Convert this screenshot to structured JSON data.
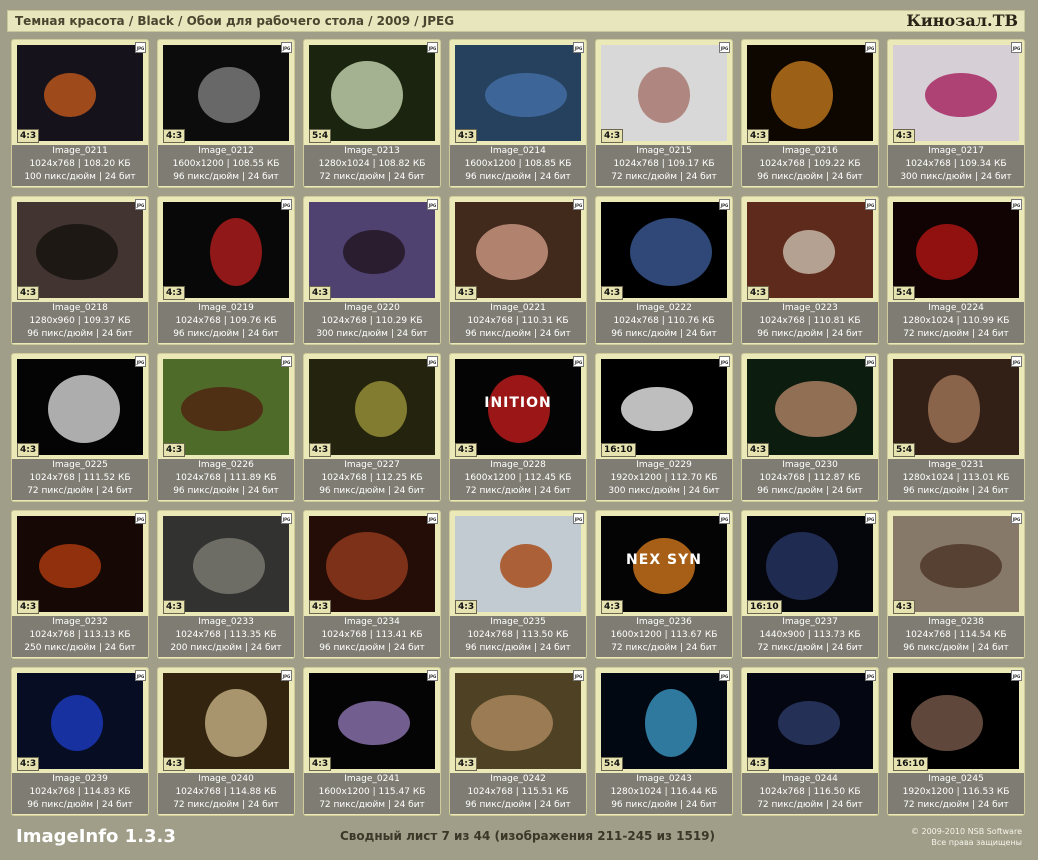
{
  "header": {
    "breadcrumb": "Темная красота / Black / Обои для рабочего стола / 2009 / JPEG",
    "brand": "Кинозал.ТВ"
  },
  "badge_jpg": "JPG",
  "cards": [
    {
      "name": "Image_0211",
      "size": "1024x768 | 108.20 КБ",
      "info": "100 пикс/дюйм | 24 бит",
      "ratio": "4:3",
      "bg": "#1a1520",
      "fg": "#d06020"
    },
    {
      "name": "Image_0212",
      "size": "1600x1200 | 108.55 КБ",
      "info": "96 пикс/дюйм | 24 бит",
      "ratio": "4:3",
      "bg": "#0e0e0e",
      "fg": "#8a8a8a"
    },
    {
      "name": "Image_0213",
      "size": "1280x1024 | 108.82 КБ",
      "info": "72 пикс/дюйм | 24 бит",
      "ratio": "5:4",
      "bg": "#1e2a10",
      "fg": "#d8e8c0"
    },
    {
      "name": "Image_0214",
      "size": "1600x1200 | 108.85 КБ",
      "info": "96 пикс/дюйм | 24 бит",
      "ratio": "4:3",
      "bg": "#2c4a6a",
      "fg": "#4b7ab8"
    },
    {
      "name": "Image_0215",
      "size": "1024x768 | 109.17 КБ",
      "info": "72 пикс/дюйм | 24 бит",
      "ratio": "4:3",
      "bg": "#f6f6f6",
      "fg": "#c08a80"
    },
    {
      "name": "Image_0216",
      "size": "1024x768 | 109.22 КБ",
      "info": "96 пикс/дюйм | 24 бит",
      "ratio": "4:3",
      "bg": "#100800",
      "fg": "#d08020"
    },
    {
      "name": "Image_0217",
      "size": "1024x768 | 109.34 КБ",
      "info": "300 пикс/дюйм | 24 бит",
      "ratio": "4:3",
      "bg": "#f4ecf4",
      "fg": "#c03070"
    },
    {
      "name": "Image_0218",
      "size": "1280x960 | 109.37 КБ",
      "info": "96 пикс/дюйм | 24 бит",
      "ratio": "4:3",
      "bg": "#4a3c38",
      "fg": "#1c1614"
    },
    {
      "name": "Image_0219",
      "size": "1024x768 | 109.76 КБ",
      "info": "96 пикс/дюйм | 24 бит",
      "ratio": "4:3",
      "bg": "#0a0a0a",
      "fg": "#c02020"
    },
    {
      "name": "Image_0220",
      "size": "1024x768 | 110.29 КБ",
      "info": "300 пикс/дюйм | 24 бит",
      "ratio": "4:3",
      "bg": "#5a4a80",
      "fg": "#2a1a2a"
    },
    {
      "name": "Image_0221",
      "size": "1024x768 | 110.31 КБ",
      "info": "96 пикс/дюйм | 24 бит",
      "ratio": "4:3",
      "bg": "#4a3020",
      "fg": "#e0a890"
    },
    {
      "name": "Image_0222",
      "size": "1024x768 | 110.76 КБ",
      "info": "96 пикс/дюйм | 24 бит",
      "ratio": "4:3",
      "bg": "#000000",
      "fg": "#4060a0"
    },
    {
      "name": "Image_0223",
      "size": "1024x768 | 110.81 КБ",
      "info": "96 пикс/дюйм | 24 бит",
      "ratio": "4:3",
      "bg": "#6a3020",
      "fg": "#e0d0c0"
    },
    {
      "name": "Image_0224",
      "size": "1280x1024 | 110.99 КБ",
      "info": "72 пикс/дюйм | 24 бит",
      "ratio": "5:4",
      "bg": "#140404",
      "fg": "#c01818"
    },
    {
      "name": "Image_0225",
      "size": "1024x768 | 111.52 КБ",
      "info": "72 пикс/дюйм | 24 бит",
      "ratio": "4:3",
      "bg": "#050505",
      "fg": "#e8e8e8"
    },
    {
      "name": "Image_0226",
      "size": "1024x768 | 111.89 КБ",
      "info": "96 пикс/дюйм | 24 бит",
      "ratio": "4:3",
      "bg": "#5a7a30",
      "fg": "#5a2c14"
    },
    {
      "name": "Image_0227",
      "size": "1024x768 | 112.25 КБ",
      "info": "96 пикс/дюйм | 24 бит",
      "ratio": "4:3",
      "bg": "#2a2a10",
      "fg": "#a8a040"
    },
    {
      "name": "Image_0228",
      "size": "1600x1200 | 112.45 КБ",
      "info": "72 пикс/дюйм | 24 бит",
      "ratio": "4:3",
      "bg": "#050505",
      "fg": "#d02020",
      "text": "INITION"
    },
    {
      "name": "Image_0229",
      "size": "1920x1200 | 112.70 КБ",
      "info": "300 пикс/дюйм | 24 бит",
      "ratio": "16:10",
      "bg": "#000000",
      "fg": "#ffffff"
    },
    {
      "name": "Image_0230",
      "size": "1024x768 | 112.87 КБ",
      "info": "96 пикс/дюйм | 24 бит",
      "ratio": "4:3",
      "bg": "#0e2010",
      "fg": "#c09070"
    },
    {
      "name": "Image_0231",
      "size": "1280x1024 | 113.01 КБ",
      "info": "96 пикс/дюйм | 24 бит",
      "ratio": "5:4",
      "bg": "#3a2418",
      "fg": "#b08060"
    },
    {
      "name": "Image_0232",
      "size": "1024x768 | 113.13 КБ",
      "info": "250 пикс/дюйм | 24 бит",
      "ratio": "4:3",
      "bg": "#1a0a06",
      "fg": "#c04010"
    },
    {
      "name": "Image_0233",
      "size": "1024x768 | 113.35 КБ",
      "info": "200 пикс/дюйм | 24 бит",
      "ratio": "4:3",
      "bg": "#3a3a38",
      "fg": "#8a8a80"
    },
    {
      "name": "Image_0234",
      "size": "1024x768 | 113.41 КБ",
      "info": "96 пикс/дюйм | 24 бит",
      "ratio": "4:3",
      "bg": "#2a0e08",
      "fg": "#a04020"
    },
    {
      "name": "Image_0235",
      "size": "1024x768 | 113.50 КБ",
      "info": "96 пикс/дюйм | 24 бит",
      "ratio": "4:3",
      "bg": "#dfe8f0",
      "fg": "#c05820"
    },
    {
      "name": "Image_0236",
      "size": "1600x1200 | 113.67 КБ",
      "info": "72 пикс/дюйм | 24 бит",
      "ratio": "4:3",
      "bg": "#050505",
      "fg": "#e08020",
      "text": "NEX SYN"
    },
    {
      "name": "Image_0237",
      "size": "1440x900 | 113.73 КБ",
      "info": "72 пикс/дюйм | 24 бит",
      "ratio": "16:10",
      "bg": "#05070e",
      "fg": "#2a3a6a"
    },
    {
      "name": "Image_0238",
      "size": "1024x768 | 114.54 КБ",
      "info": "96 пикс/дюйм | 24 бит",
      "ratio": "4:3",
      "bg": "#9a8a78",
      "fg": "#5a4030"
    },
    {
      "name": "Image_0239",
      "size": "1024x768 | 114.83 КБ",
      "info": "96 пикс/дюйм | 24 бит",
      "ratio": "4:3",
      "bg": "#08102a",
      "fg": "#2040d0"
    },
    {
      "name": "Image_0240",
      "size": "1024x768 | 114.88 КБ",
      "info": "72 пикс/дюйм | 24 бит",
      "ratio": "4:3",
      "bg": "#3a2a10",
      "fg": "#d8c090"
    },
    {
      "name": "Image_0241",
      "size": "1600x1200 | 115.47 КБ",
      "info": "72 пикс/дюйм | 24 бит",
      "ratio": "4:3",
      "bg": "#050505",
      "fg": "#9a80c0"
    },
    {
      "name": "Image_0242",
      "size": "1024x768 | 115.51 КБ",
      "info": "96 пикс/дюйм | 24 бит",
      "ratio": "4:3",
      "bg": "#5a4a2a",
      "fg": "#c09868"
    },
    {
      "name": "Image_0243",
      "size": "1280x1024 | 116.44 КБ",
      "info": "96 пикс/дюйм | 24 бит",
      "ratio": "5:4",
      "bg": "#020a14",
      "fg": "#40a0d0"
    },
    {
      "name": "Image_0244",
      "size": "1024x768 | 116.50 КБ",
      "info": "72 пикс/дюйм | 24 бит",
      "ratio": "4:3",
      "bg": "#050814",
      "fg": "#304070"
    },
    {
      "name": "Image_0245",
      "size": "1920x1200 | 116.53 КБ",
      "info": "72 пикс/дюйм | 24 бит",
      "ratio": "16:10",
      "bg": "#000000",
      "fg": "#806050"
    }
  ],
  "footer": {
    "app_title": "ImageInfo 1.3.3",
    "summary": "Сводный лист 7 из 44 (изображения 211-245 из 1519)",
    "copyright": "© 2009-2010 NSB Software",
    "rights": "Все права защищены"
  }
}
